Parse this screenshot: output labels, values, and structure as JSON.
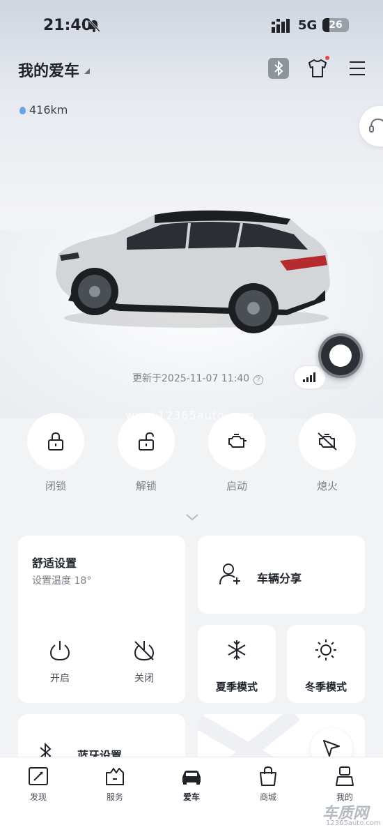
{
  "status_bar": {
    "time": "21:40",
    "network": "5G",
    "battery": "26"
  },
  "header": {
    "title": "我的爱车"
  },
  "vehicle": {
    "range": "416km"
  },
  "update": {
    "text": "更新于2025-11-07 11:40",
    "info_glyph": "?"
  },
  "watermark": "www.12365auto.com",
  "actions": [
    {
      "label": "闭锁",
      "icon": "lock-icon"
    },
    {
      "label": "解锁",
      "icon": "unlock-icon"
    },
    {
      "label": "启动",
      "icon": "engine-icon"
    },
    {
      "label": "熄火",
      "icon": "engine-off-icon"
    }
  ],
  "comfort": {
    "title": "舒适设置",
    "subtitle": "设置温度 18°",
    "on_label": "开启",
    "off_label": "关闭"
  },
  "share": {
    "label": "车辆分享"
  },
  "modes": {
    "summer": "夏季模式",
    "winter": "冬季模式"
  },
  "bluetooth_card": {
    "label": "蓝牙设置"
  },
  "tabs": [
    {
      "label": "发现",
      "icon": "compass-icon"
    },
    {
      "label": "服务",
      "icon": "service-icon"
    },
    {
      "label": "爱车",
      "icon": "car-icon"
    },
    {
      "label": "商城",
      "icon": "shop-icon"
    },
    {
      "label": "我的",
      "icon": "profile-icon"
    }
  ],
  "brand": {
    "mark": "车质网",
    "url": "12365auto.com"
  },
  "colors": {
    "accent_dark": "#1f2329",
    "badge_red": "#e8474a",
    "range_drop": "#6aa4e8"
  }
}
